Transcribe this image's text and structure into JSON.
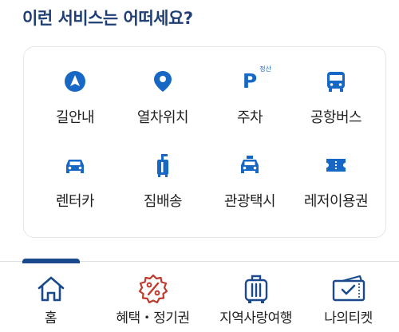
{
  "section": {
    "title": "이런 서비스는 어떠세요?"
  },
  "services": [
    {
      "label": "길안내",
      "icon": "navigation-icon"
    },
    {
      "label": "열차위치",
      "icon": "location-pin-icon"
    },
    {
      "label": "주차",
      "icon": "parking-icon",
      "badge": "정산"
    },
    {
      "label": "공항버스",
      "icon": "bus-icon"
    },
    {
      "label": "렌터카",
      "icon": "car-icon"
    },
    {
      "label": "짐배송",
      "icon": "luggage-icon"
    },
    {
      "label": "관광택시",
      "icon": "taxi-icon"
    },
    {
      "label": "레저이용권",
      "icon": "ticket-icon"
    }
  ],
  "nav": {
    "active": "home",
    "items": [
      {
        "label": "홈",
        "icon": "home-icon"
      },
      {
        "label": "혜택・정기권",
        "icon": "discount-badge-icon"
      },
      {
        "label": "지역사랑여행",
        "icon": "suitcase-icon"
      },
      {
        "label": "나의티켓",
        "icon": "my-ticket-icon"
      }
    ]
  },
  "colors": {
    "title": "#1f3f74",
    "icon_blue": "#1767c4",
    "benefit_red": "#c0392b",
    "nav_blue": "#1a4a8c"
  }
}
